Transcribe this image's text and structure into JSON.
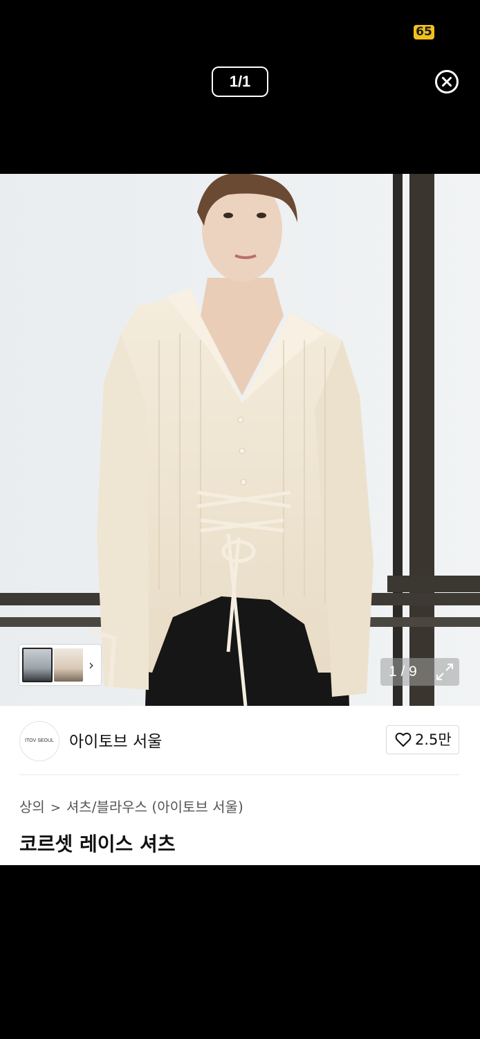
{
  "status_bar": {
    "battery_level": "65",
    "battery_color": "#f2c01e"
  },
  "viewer": {
    "image_counter": "1/1",
    "close_icon": "close-circle-icon"
  },
  "product_gallery": {
    "photo_counter": "1 / 9",
    "expand_icon": "expand-icon",
    "thumbnail_next_icon": "chevron-right-icon"
  },
  "brand": {
    "logo_text": "ITOV SEOUL",
    "name": "아이토브 서울",
    "like_icon": "heart-outline-icon",
    "like_count": "2.5만"
  },
  "breadcrumb": {
    "category": "상의",
    "separator_icon": "chevron-right-icon",
    "subcategory": "셔츠/블라우스 (아이토브 서울)"
  },
  "product": {
    "title": "코르셋 레이스 셔츠"
  }
}
